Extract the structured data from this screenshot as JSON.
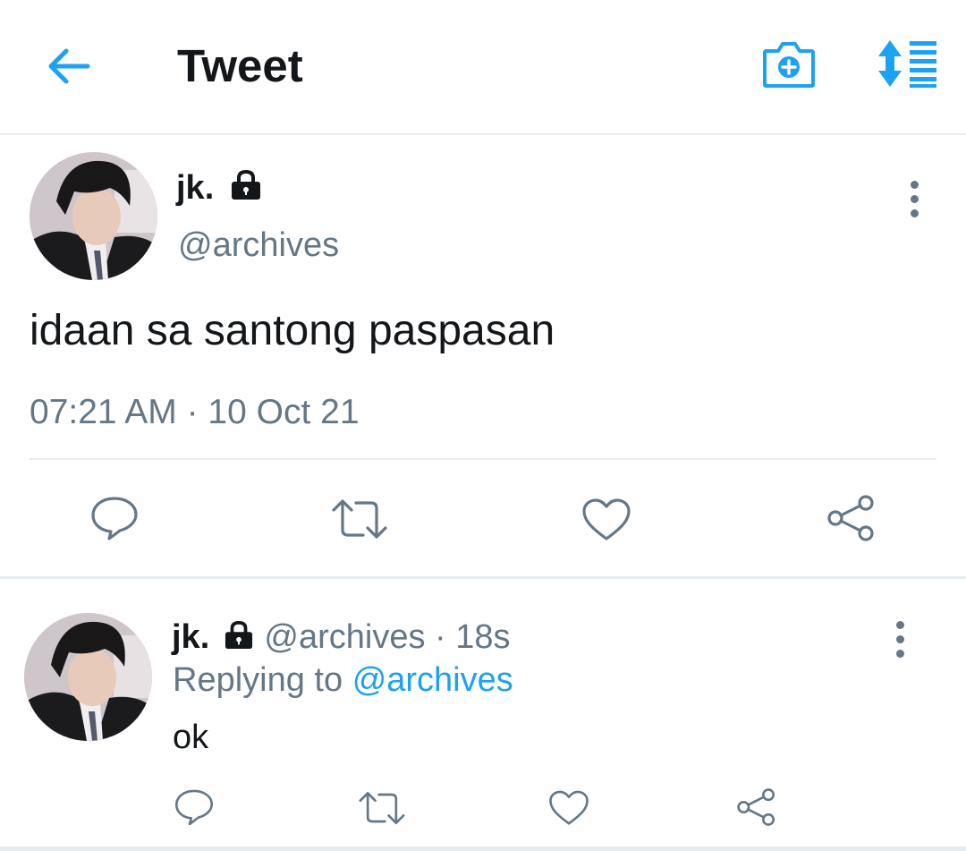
{
  "header": {
    "title": "Tweet",
    "back_icon": "arrow-left-icon",
    "camera_icon": "camera-plus-icon",
    "sort_icon": "sort-list-icon",
    "accent": "#1da1f2"
  },
  "main_tweet": {
    "name": "jk.",
    "protected_icon": "lock-icon",
    "handle": "@archives",
    "text": "idaan sa santong paspasan",
    "timestamp": "07:21 AM · 10 Oct 21",
    "actions": [
      "reply-icon",
      "retweet-icon",
      "like-icon",
      "share-icon"
    ]
  },
  "reply_tweet": {
    "name": "jk.",
    "handle_time": "@archives · 18s",
    "replying_prefix": "Replying to",
    "replying_to": "@archives",
    "text": "ok",
    "actions": [
      "reply-icon",
      "retweet-icon",
      "like-icon",
      "share-icon"
    ]
  },
  "colors": {
    "text": "#14171a",
    "secondary": "#657786",
    "divider": "#e6ecf0"
  }
}
